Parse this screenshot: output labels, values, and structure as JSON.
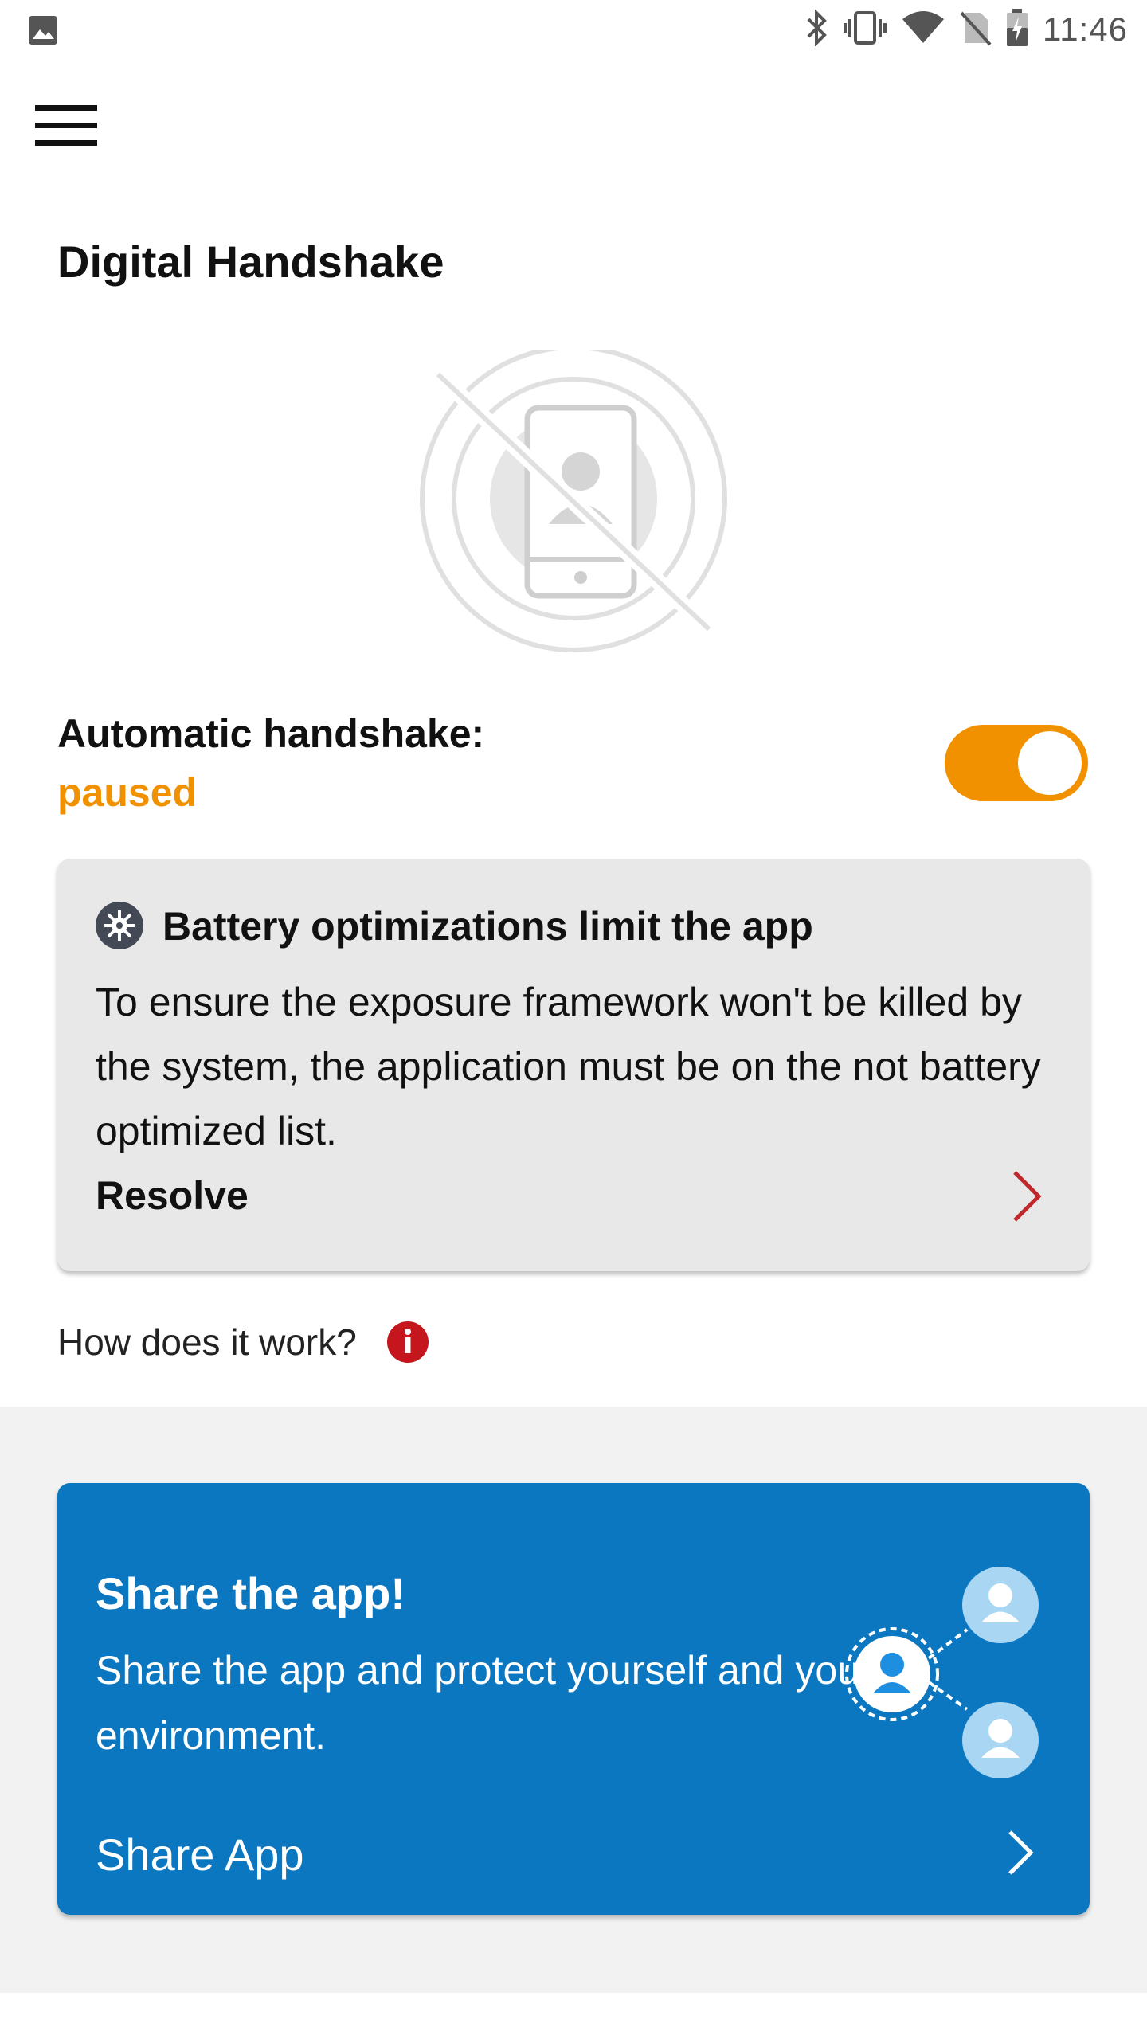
{
  "status_bar": {
    "time": "11:46",
    "icons": [
      "image-icon",
      "bluetooth-icon",
      "vibrate-icon",
      "wifi-icon",
      "no-sim-icon",
      "battery-charging-icon"
    ]
  },
  "app_bar": {
    "menu_icon": "hamburger-menu-icon"
  },
  "page": {
    "title": "Digital Handshake"
  },
  "handshake": {
    "label": "Automatic handshake:",
    "status": "paused",
    "toggle_on": true,
    "accent_color": "#f29100"
  },
  "battery_card": {
    "icon": "gear-icon",
    "title": "Battery optimizations limit the app",
    "text": "To ensure the exposure framework won't be killed by the system, the application must be on the not battery optimized list.",
    "action_label": "Resolve",
    "action_icon": "chevron-right-icon",
    "chevron_color": "#c0282d"
  },
  "how_it_works": {
    "label": "How does it work?",
    "icon": "info-icon",
    "icon_color": "#c4161c"
  },
  "share_card": {
    "title": "Share the app!",
    "text": "Share the app and protect yourself and your environment.",
    "action_label": "Share App",
    "action_icon": "chevron-right-icon",
    "background_color": "#0b77c0"
  }
}
